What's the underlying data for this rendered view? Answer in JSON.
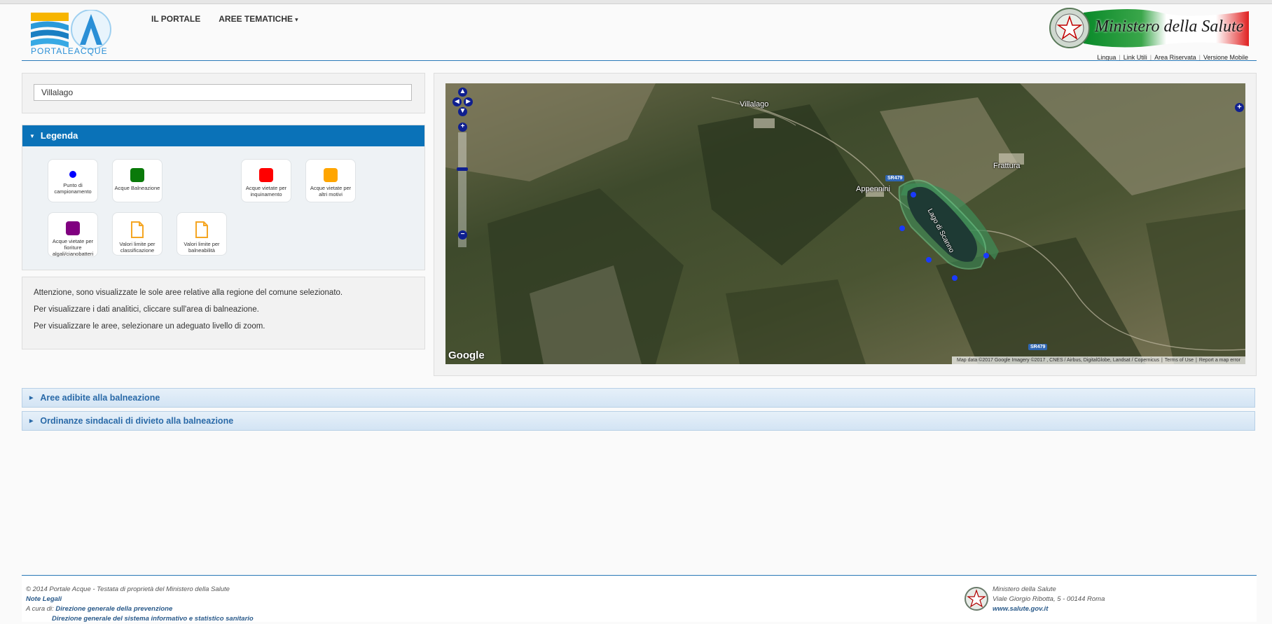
{
  "header": {
    "logo_text": "PORTALEACQUE",
    "nav": [
      "IL PORTALE",
      "AREE TEMATICHE"
    ],
    "ministry_logo_text": "Ministero della Salute",
    "top_links": [
      "Lingua",
      "Link Utili",
      "Area Riservata",
      "Versione Mobile"
    ]
  },
  "search": {
    "value": "Villalago"
  },
  "legend": {
    "title": "Legenda",
    "items": [
      {
        "label": "Punto di campionamento",
        "icon": "blue-dot",
        "color": "#0000ff"
      },
      {
        "label": "Acque Balneazione",
        "icon": "square",
        "color": "#0a7a0a"
      },
      {
        "label": "Acque vietate per inquinamento",
        "icon": "square",
        "color": "#ff0000"
      },
      {
        "label": "Acque vietate per altri motivi",
        "icon": "square",
        "color": "#ffa500"
      },
      {
        "label": "Acque vietate per fioriture algali/cianobatteri",
        "icon": "square",
        "color": "#800080"
      },
      {
        "label": "Valori limite per classificazione",
        "icon": "document-icon",
        "color": "#f5a623"
      },
      {
        "label": "Valori limite per balneabilità",
        "icon": "document-icon",
        "color": "#f5a623"
      }
    ]
  },
  "info": [
    "Attenzione, sono visualizzate le sole aree relative alla regione del comune selezionato.",
    "Per visualizzare i dati analitici, cliccare sull'area di balneazione.",
    "Per visualizzare le aree, selezionare un adeguato livello di zoom."
  ],
  "map": {
    "labels": {
      "villalago": "Villalago",
      "frattura": "Frattura",
      "appennini": "Appennini",
      "lake": "Lago di Scanno"
    },
    "roads": [
      "SR479",
      "SR479"
    ],
    "google": "Google",
    "attribution": [
      "Map data ©2017 Google Imagery ©2017 , CNES / Airbus, DigitalGlobe, Landsat / Copernicus",
      "Terms of Use",
      "Report a map error"
    ]
  },
  "accordions": [
    "Aree adibite alla balneazione",
    "Ordinanze sindacali di divieto alla balneazione"
  ],
  "footer": {
    "left": {
      "line1": "© 2014 Portale Acque - Testata di proprietà del Ministero della Salute",
      "note": "Note Legali",
      "acura_prefix": "A cura di:",
      "dept1": "Direzione generale della prevenzione",
      "dept2": "Direzione generale del sistema informativo e statistico sanitario"
    },
    "right": {
      "name": "Ministero della Salute",
      "address": "Viale Giorgio Ribotta, 5 - 00144 Roma",
      "site": "www.salute.gov.it"
    }
  }
}
